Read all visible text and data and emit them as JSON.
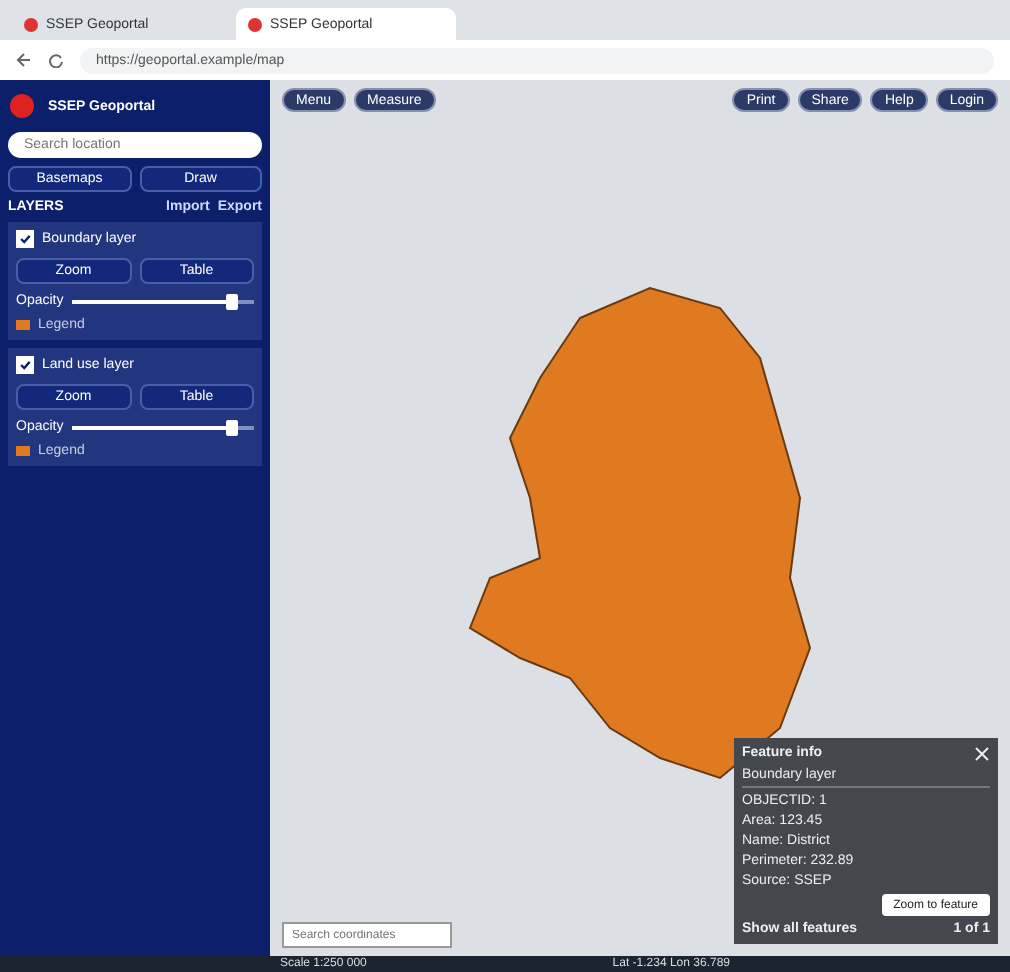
{
  "browser": {
    "tabs": [
      {
        "title": "SSEP Geoportal",
        "selected": false
      },
      {
        "title": "SSEP Geoportal",
        "selected": true
      }
    ],
    "address": "https://geoportal.example/map"
  },
  "sidebar": {
    "title": "SSEP Geoportal",
    "search": {
      "placeholder": "Search location"
    },
    "actions": [
      "Basemaps",
      "Draw"
    ],
    "layers_header": "LAYERS",
    "layer_actions": [
      "Import",
      "Export"
    ],
    "layers": [
      {
        "name": "Boundary layer",
        "checked": true,
        "buttons": [
          "Zoom",
          "Table"
        ],
        "opacity_label": "Opacity",
        "level": 0.88,
        "legend": "Legend"
      },
      {
        "name": "Land use layer",
        "checked": true,
        "buttons": [
          "Zoom",
          "Table"
        ],
        "opacity_label": "Opacity",
        "level": 0.88,
        "legend": "Legend"
      }
    ]
  },
  "map": {
    "toolbar_left": [
      "Menu",
      "Measure"
    ],
    "toolbar_right": [
      "Print",
      "Share",
      "Help",
      "Login"
    ],
    "coordinate_field": {
      "placeholder": "Search coordinates"
    }
  },
  "info_panel": {
    "title": "Feature info",
    "layer": "Boundary layer",
    "attributes": [
      "OBJECTID: 1",
      "Area: 123.45",
      "Name: District",
      "Perimeter: 232.89",
      "Source: SSEP"
    ],
    "action": "Zoom to feature",
    "footer": "Show all features",
    "status": "1 of 1"
  },
  "status_bar": {
    "left": "Scale 1:250 000",
    "right": "Lat -1.234  Lon 36.789"
  }
}
